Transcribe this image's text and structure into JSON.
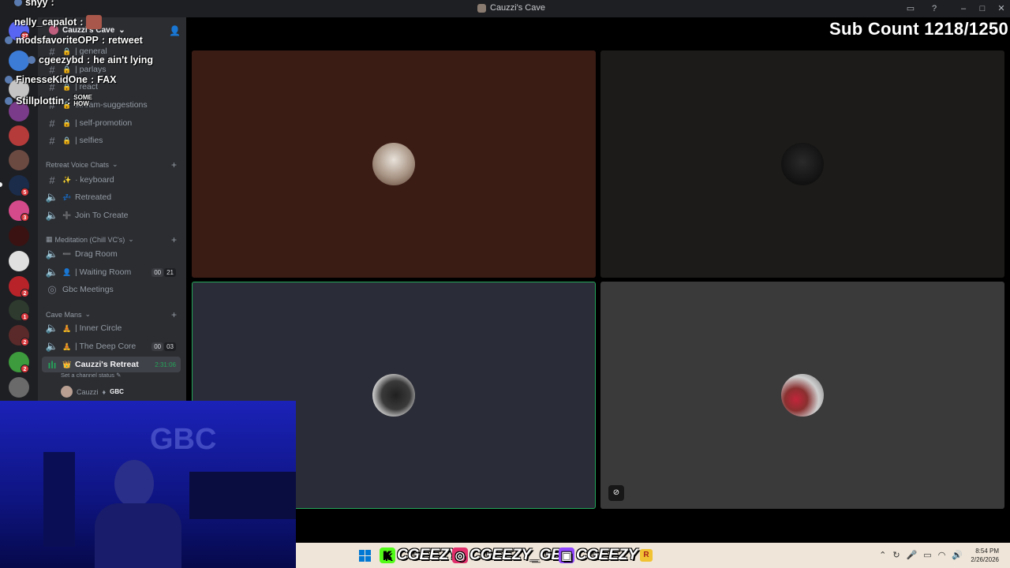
{
  "window": {
    "title": "Cauzzi's Cave"
  },
  "server": {
    "name": "Cauzzi's Cave"
  },
  "channels_top": [
    {
      "label": "| general",
      "emoji": ""
    },
    {
      "label": "| parlays",
      "emoji": ""
    },
    {
      "label": "| react",
      "emoji": ""
    },
    {
      "label": "stream-suggestions",
      "emoji": ""
    },
    {
      "label": "| self-promotion",
      "emoji": ""
    },
    {
      "label": "| selfies",
      "emoji": ""
    }
  ],
  "categories": {
    "retreat": "Retreat Voice Chats",
    "meditation": "Meditation (Chill VC's)",
    "cave_mans": "Cave Mans"
  },
  "retreat_channels": [
    {
      "label": "· keyboard",
      "emoji": "✨"
    },
    {
      "label": "Retreated",
      "emoji": "💤"
    },
    {
      "label": "Join To Create",
      "emoji": "➕"
    }
  ],
  "meditation_channels": [
    {
      "label": "Drag Room",
      "emoji": "➖"
    },
    {
      "label": "| Waiting Room",
      "emoji": "👤",
      "counter": [
        "00",
        "21"
      ]
    },
    {
      "label": "Gbc Meetings",
      "emoji": ""
    }
  ],
  "cave_channels": [
    {
      "label": "| Inner Circle",
      "emoji": "🧘"
    },
    {
      "label": "| The Deep Core",
      "emoji": "🧘",
      "counter": [
        "00",
        "03"
      ]
    },
    {
      "label": "Cauzzi's Retreat",
      "emoji": "👑",
      "timer": "2:31:06"
    }
  ],
  "channel_status": "Set a channel status",
  "voice_user": {
    "name": "Cauzzi",
    "tag": "GBC"
  },
  "server_badges": [
    "27",
    "5",
    "3",
    "2",
    "2",
    "1",
    "2"
  ],
  "chat": [
    {
      "name": "shyy",
      "msg": ""
    },
    {
      "name": "nelly_capalot",
      "msg": ""
    },
    {
      "name": "modsfavoriteOPP",
      "msg": "retweet"
    },
    {
      "name": "cgeezybd",
      "msg": "he ain't lying"
    },
    {
      "name": "FinesseKidOne",
      "msg": "FAX"
    },
    {
      "name": "Stillplottin",
      "msg": "SOME HOW"
    }
  ],
  "stage": {
    "subcount": "Sub Count 1218/1250"
  },
  "webcam": {
    "sign": "GBC"
  },
  "socials": [
    {
      "icon": "kick-icon",
      "handle": "CGEEZY",
      "color": "#53fc18"
    },
    {
      "icon": "instagram-icon",
      "handle": "CGEEZY_GBC",
      "color": "#e1306c"
    },
    {
      "icon": "twitch-icon",
      "handle": "CGEEZY",
      "color": "#9146ff"
    }
  ],
  "clock": {
    "time": "8:54 PM",
    "date": "2/26/2026"
  }
}
